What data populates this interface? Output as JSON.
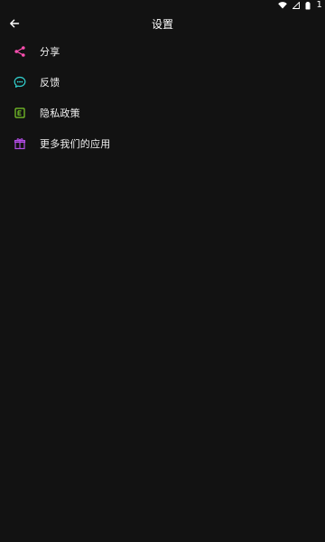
{
  "status_bar": {
    "time": "1"
  },
  "header": {
    "title": "设置"
  },
  "menu": {
    "items": [
      {
        "label": "分享",
        "icon": "share-icon",
        "color": "#ff4fb1"
      },
      {
        "label": "反馈",
        "icon": "chat-bubble-icon",
        "color": "#32d3d1"
      },
      {
        "label": "隐私政策",
        "icon": "document-icon",
        "color": "#7ccc2a"
      },
      {
        "label": "更多我们的应用",
        "icon": "gift-icon",
        "color": "#b34de6"
      }
    ]
  }
}
